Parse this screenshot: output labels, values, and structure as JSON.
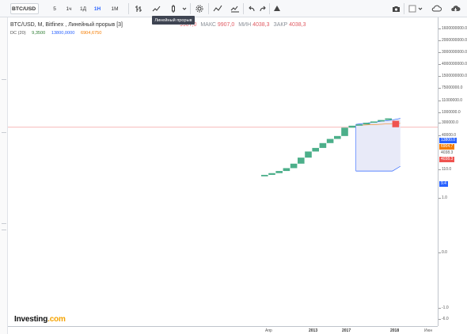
{
  "toolbar": {
    "symbol": "BTC/USD",
    "intervals": [
      "5",
      "1ч",
      "1Д",
      "1Н",
      "1М"
    ],
    "active_interval": "1Н",
    "tooltip": "Линейный прорыв",
    "icons": [
      "bars-icon",
      "candles-icon",
      "chart-type-icon",
      "chevron-down-icon",
      "settings-icon",
      "compare-icon",
      "undo-icon",
      "redo-icon",
      "alert-icon",
      "camera-icon",
      "layout-icon",
      "cloud-icon"
    ]
  },
  "legend": {
    "title": "BTC/USD, M, Bitfinex , Линейный прорыв [3]",
    "open_value": "9907,0",
    "high_label": "МАКС",
    "high_value": "9907,0",
    "low_label": "МИН",
    "low_value": "4038,3",
    "close_label": "ЗАКР",
    "close_value": "4038,3",
    "indicator": "DC (20)",
    "ind_v1": "9,3500",
    "ind_v2": "13800,0000",
    "ind_v3": "6904,6750"
  },
  "price_scale": {
    "ticks": [
      "1600000000.0",
      "2000000000.0",
      "3000000000.0",
      "4000000000.0",
      "1500000000.0",
      "75000000.0",
      "11000000.0",
      "1000000.0",
      "300000.0",
      "40000.0",
      "110.0",
      "1.0",
      "0.0",
      "-1.0",
      "-6.0"
    ],
    "labels": {
      "upper": "13800.0",
      "last": "6904.7",
      "low1": "4038.3",
      "low2": "4038.3",
      "dc_low": "9.4"
    },
    "colors": {
      "upper": "#2962ff",
      "last": "#f57c00",
      "low1": "#9e9e9e",
      "low2": "#ef5350",
      "dc_low": "#2962ff"
    }
  },
  "time_scale": {
    "labels": [
      "Апр",
      "2013",
      "2017",
      "2018",
      "Июн"
    ]
  },
  "logo": {
    "text": "Investing",
    "suffix": ".com"
  },
  "chart_data": {
    "type": "line_break",
    "symbol": "BTC/USD",
    "exchange": "Bitfinex",
    "interval": "M",
    "bricks": [
      {
        "open": 4.5,
        "close": 5.5,
        "dir": "up"
      },
      {
        "open": 5.5,
        "close": 7.0,
        "dir": "up"
      },
      {
        "open": 7.0,
        "close": 9.4,
        "dir": "up"
      },
      {
        "open": 9.4,
        "close": 14.0,
        "dir": "up"
      },
      {
        "open": 14.0,
        "close": 26.0,
        "dir": "up"
      },
      {
        "open": 26.0,
        "close": 60.0,
        "dir": "up"
      },
      {
        "open": 60.0,
        "close": 140.0,
        "dir": "up"
      },
      {
        "open": 140.0,
        "close": 230.0,
        "dir": "up"
      },
      {
        "open": 230.0,
        "close": 450.0,
        "dir": "up"
      },
      {
        "open": 450.0,
        "close": 800.0,
        "dir": "up"
      },
      {
        "open": 800.0,
        "close": 1200.0,
        "dir": "up"
      },
      {
        "open": 1200.0,
        "close": 3800.0,
        "dir": "up"
      },
      {
        "open": 3800.0,
        "close": 5000.0,
        "dir": "up"
      },
      {
        "open": 5000.0,
        "close": 6000.0,
        "dir": "up"
      },
      {
        "open": 6000.0,
        "close": 7500.0,
        "dir": "up"
      },
      {
        "open": 7500.0,
        "close": 9000.0,
        "dir": "up"
      },
      {
        "open": 9000.0,
        "close": 11000.0,
        "dir": "up"
      },
      {
        "open": 11000.0,
        "close": 13800.0,
        "dir": "up"
      },
      {
        "open": 9907.0,
        "close": 4038.3,
        "dir": "down"
      }
    ],
    "donchian": {
      "length": 20,
      "lower": 9.35,
      "upper": 13800.0,
      "basis": 6904.675
    },
    "last_price": 4038.3,
    "colors": {
      "up": "#4caf8a",
      "down": "#ef5350",
      "channel": "#2962ff",
      "fill": "#e8eaf8",
      "hline": "#f2a0a0"
    }
  }
}
